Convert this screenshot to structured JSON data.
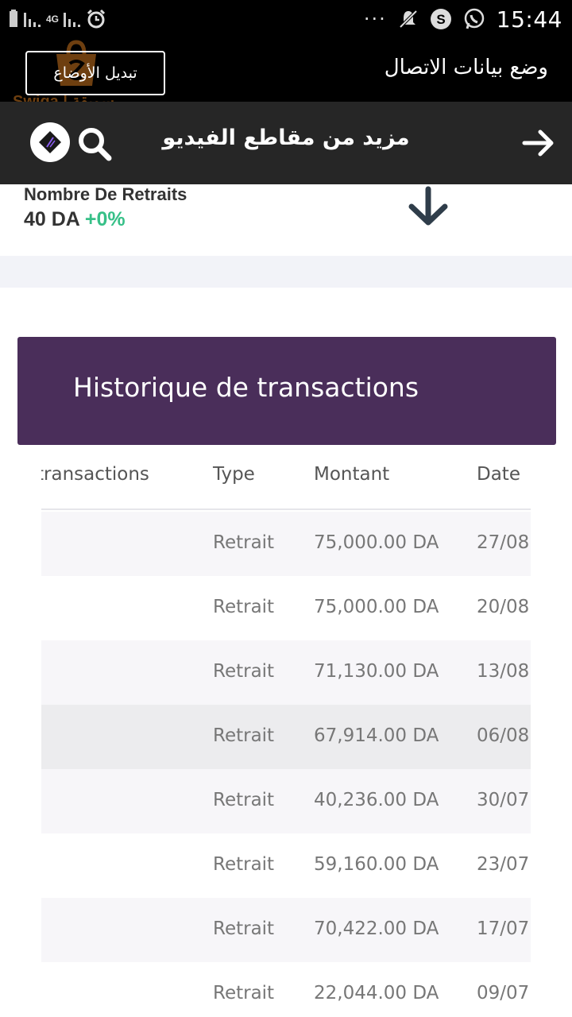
{
  "status_bar": {
    "time": "15:44",
    "network": "4G",
    "more": "···",
    "icons": [
      "battery-icon",
      "signal-icon",
      "alarm-icon",
      "mute-icon",
      "s-app-icon",
      "whatsapp-icon"
    ]
  },
  "mode_bar": {
    "title": "وضع بيانات الاتصال",
    "button_label": "تبديل الأوضاع",
    "watermark": "Swiga | سويقة"
  },
  "video_bar": {
    "title": "مزيد من مقاطع الفيديو"
  },
  "stats": {
    "label": "Nombre De Retraits",
    "value": "40 DA",
    "change": "+0%"
  },
  "history": {
    "title": "Historique de transactions",
    "columns": [
      "transactions",
      "Type",
      "Montant",
      "Date"
    ],
    "rows": [
      {
        "type": "Retrait",
        "amount": "75,000.00 DA",
        "date": "27/08"
      },
      {
        "type": "Retrait",
        "amount": "75,000.00 DA",
        "date": "20/08"
      },
      {
        "type": "Retrait",
        "amount": "71,130.00 DA",
        "date": "13/08"
      },
      {
        "type": "Retrait",
        "amount": "67,914.00 DA",
        "date": "06/08"
      },
      {
        "type": "Retrait",
        "amount": "40,236.00 DA",
        "date": "30/07"
      },
      {
        "type": "Retrait",
        "amount": "59,160.00 DA",
        "date": "23/07"
      },
      {
        "type": "Retrait",
        "amount": "70,422.00 DA",
        "date": "17/07"
      },
      {
        "type": "Retrait",
        "amount": "22,044.00 DA",
        "date": "09/07"
      }
    ]
  },
  "colors": {
    "header_purple": "#4a2e5a",
    "positive_green": "#37c088",
    "video_bar": "#262626"
  }
}
